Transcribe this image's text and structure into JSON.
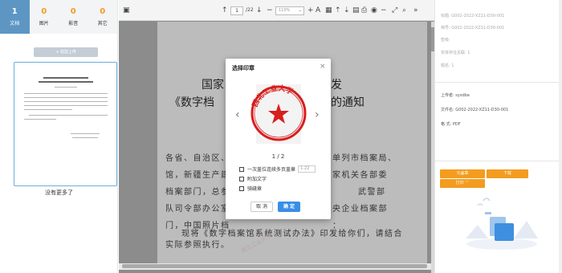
{
  "left_panel": {
    "tabs": [
      {
        "count": "1",
        "label": "文档"
      },
      {
        "count": "0",
        "label": "图片"
      },
      {
        "count": "0",
        "label": "影音"
      },
      {
        "count": "0",
        "label": "其它"
      }
    ],
    "upload_label": "+ 追加上传",
    "no_more": "没有更多了"
  },
  "toolbar": {
    "page_current": "1",
    "page_total": "/22",
    "zoom": "110%"
  },
  "document": {
    "title_left_1": "国家",
    "title_right_1": "发",
    "title_left_2": "《数字档",
    "title_right_2": "的通知",
    "lines_left": [
      "各省、自治区、",
      "馆，新疆生产建",
      "档案部门，总参",
      "队司令部办公室",
      "门，中国照片档"
    ],
    "lines_right": [
      "单列市档案局、",
      "家机关各部委",
      "武警部",
      "央企业档案部",
      "："
    ],
    "para2": "现将《数字档案馆系统测试办法》印发给你们，请结合",
    "para3": "实际参照执行。",
    "stamp_text": "西北工业大学"
  },
  "modal": {
    "title": "选择印章",
    "close": "×",
    "seal_text": "西北工业大学",
    "counter": "1 / 2",
    "opt_pages": "一次盖位连续多页盖章",
    "opt_pages_value": "1-22",
    "opt_text": "附加文字",
    "opt_seam": "骑缝章",
    "cancel": "取 消",
    "ok": "确 定"
  },
  "right_panel": {
    "title_line": "标题: G002-2022-XZ11-D30-001",
    "code_line": "档号: G002-2022-XZ11-D30-001",
    "security": "密级:",
    "entity": "实体存址关联: 1",
    "pages": "题名: 1",
    "uploader": "上传者: sysdba",
    "filename": "文件名: G002-2022-XZ11-D30-001",
    "format": "格 式: PDF",
    "btn_seal": "元盖章",
    "btn_download": "下载",
    "btn_print": "打印 ﹀"
  },
  "colors": {
    "accent_orange": "#f39c1f",
    "tab_active": "#5e96c3",
    "primary_blue": "#3a8ee6",
    "seal_red": "#d81e1e"
  }
}
